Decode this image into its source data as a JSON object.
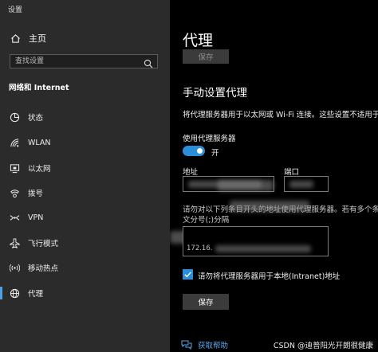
{
  "window_title": "设置",
  "sidebar": {
    "home_label": "主页",
    "search_placeholder": "查找设置",
    "section_title": "网络和 Internet",
    "items": [
      {
        "label": "状态",
        "icon": "status-icon"
      },
      {
        "label": "WLAN",
        "icon": "wifi-icon"
      },
      {
        "label": "以太网",
        "icon": "ethernet-icon"
      },
      {
        "label": "拨号",
        "icon": "dialup-icon"
      },
      {
        "label": "VPN",
        "icon": "vpn-icon"
      },
      {
        "label": "飞行模式",
        "icon": "airplane-icon"
      },
      {
        "label": "移动热点",
        "icon": "hotspot-icon"
      },
      {
        "label": "代理",
        "icon": "globe-icon",
        "active": true
      }
    ]
  },
  "main": {
    "title": "代理",
    "top_save_label": "保存",
    "manual_heading": "手动设置代理",
    "manual_desc": "将代理服务器用于以太网或 Wi-Fi 连接。这些设置不适用于 V",
    "use_proxy_label": "使用代理服务器",
    "toggle_state": "开",
    "address_label": "地址",
    "port_label": "端口",
    "exceptions_desc_line1": "请勿对以下列条目开头的地址使用代理服务器。若有多个条目",
    "exceptions_desc_line2": "文分号(;)分隔",
    "exceptions_partial": "172.16.",
    "local_bypass_label": "请勿将代理服务器用于本地(Intranet)地址",
    "bottom_save_label": "保存",
    "help_label": "获取帮助"
  },
  "watermark": "CSDN @迪普阳光开朗很健康",
  "colors": {
    "accent": "#2a8fd8",
    "sidebar_bg": "#2b2b2b",
    "main_bg": "#000000",
    "link": "#5ba7ea"
  }
}
